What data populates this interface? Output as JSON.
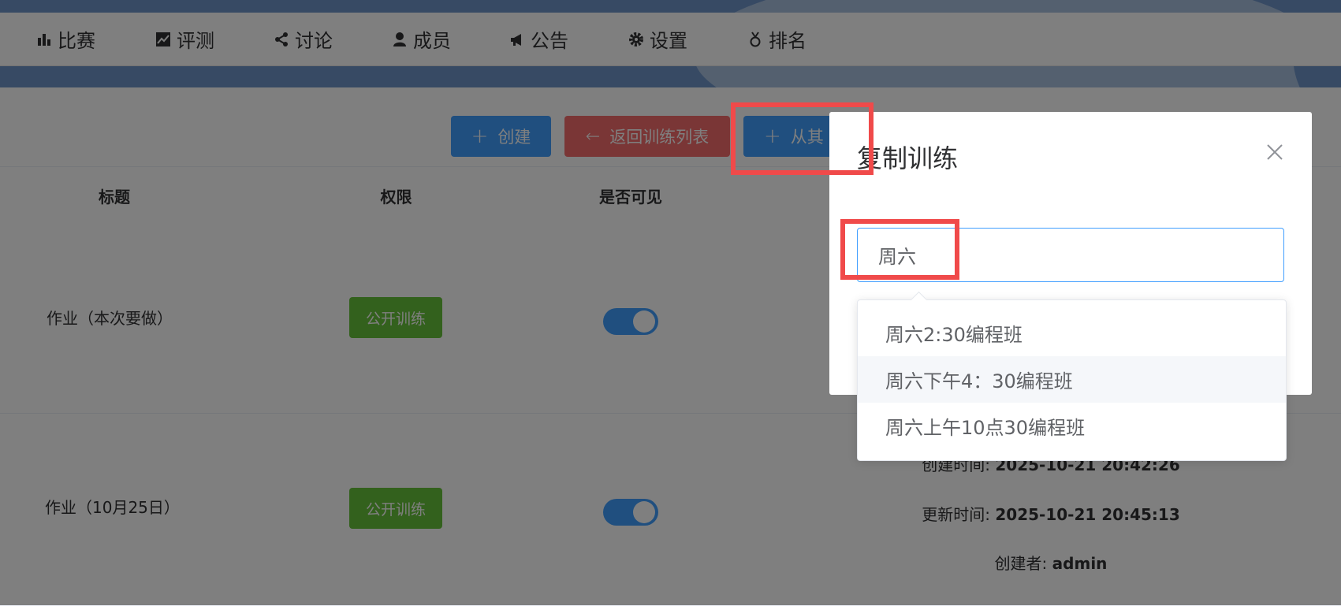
{
  "nav": {
    "items": [
      {
        "label": "比赛",
        "icon": "bar-chart-icon"
      },
      {
        "label": "评测",
        "icon": "line-chart-icon"
      },
      {
        "label": "讨论",
        "icon": "share-icon"
      },
      {
        "label": "成员",
        "icon": "user-icon"
      },
      {
        "label": "公告",
        "icon": "megaphone-icon"
      },
      {
        "label": "设置",
        "icon": "gear-icon"
      },
      {
        "label": "排名",
        "icon": "medal-icon"
      }
    ]
  },
  "toolbar": {
    "create_label": "创建",
    "back_label": "返回训练列表",
    "copy_from_label": "从其"
  },
  "table": {
    "headers": [
      "标题",
      "权限",
      "是否可见"
    ],
    "rows": [
      {
        "title": "作业（本次要做）",
        "permission": "公开训练",
        "visible": true
      },
      {
        "title": "作业（10月25日）",
        "permission": "公开训练",
        "visible": true,
        "created_label": "创建时间:",
        "created_value": "2025-10-21 20:42:26",
        "updated_label": "更新时间:",
        "updated_value": "2025-10-21 20:45:13",
        "creator_label": "创建者:",
        "creator_value": "admin"
      }
    ]
  },
  "dialog": {
    "title": "复制训练",
    "search_value": "周六",
    "options": [
      "周六2:30编程班",
      "周六下午4：30编程班",
      "周六上午10点30编程班"
    ],
    "hovered_index": 1
  },
  "colors": {
    "primary": "#409eff",
    "danger": "#f56c6c",
    "success": "#67c23a",
    "highlight": "#f04a4a"
  }
}
